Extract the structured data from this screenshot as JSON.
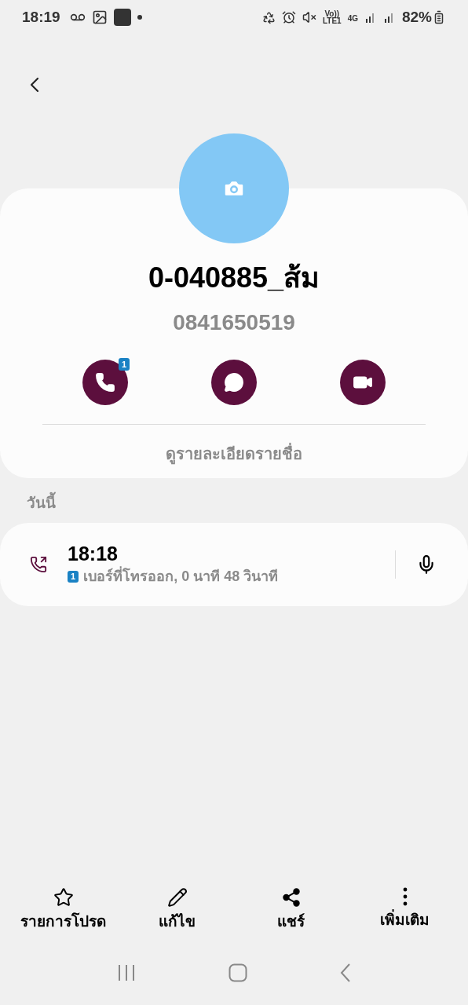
{
  "status_bar": {
    "time": "18:19",
    "network": [
      "Vo))",
      "LTE1",
      "4G"
    ],
    "battery": "82%"
  },
  "contact": {
    "name": "0-040885_ส้ม",
    "phone": "0841650519"
  },
  "actions": [
    {
      "kind": "call",
      "badge": "1"
    },
    {
      "kind": "message"
    },
    {
      "kind": "video"
    }
  ],
  "details_link": "ดูรายละเอียดรายชื่อ",
  "history": {
    "section": "วันนี้",
    "calls": [
      {
        "kind": "outgoing",
        "time": "18:18",
        "sim": "1",
        "detail": "เบอร์ที่โทรออก, 0 นาที 48 วินาที"
      }
    ]
  },
  "bottom_bar": [
    {
      "kind": "favorite",
      "label": "รายการโปรด"
    },
    {
      "kind": "edit",
      "label": "แก้ไข"
    },
    {
      "kind": "share",
      "label": "แชร์"
    },
    {
      "kind": "more",
      "label": "เพิ่มเติม"
    }
  ]
}
